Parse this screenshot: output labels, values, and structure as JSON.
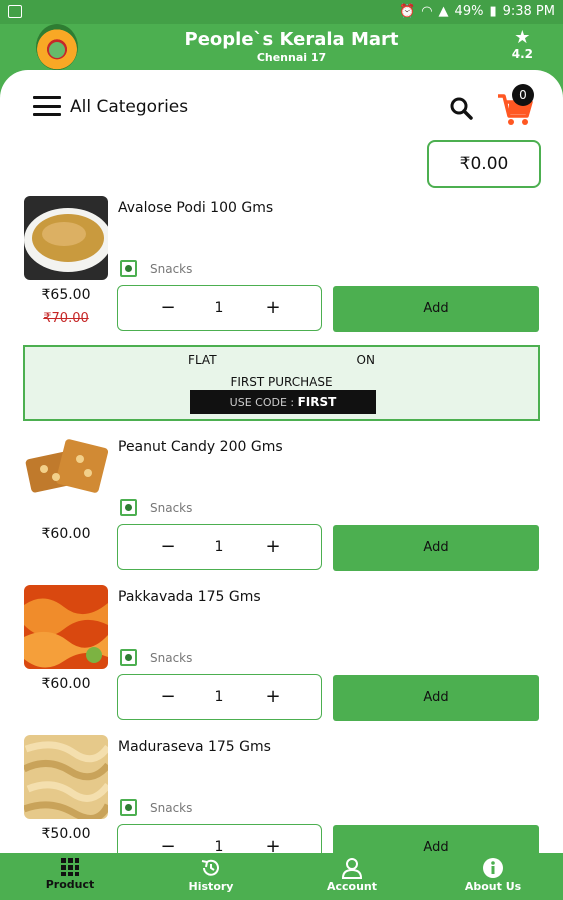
{
  "status_bar": {
    "battery": "49%",
    "time": "9:38 PM"
  },
  "app": {
    "title": "People`s Kerala Mart",
    "subtitle": "Chennai 17",
    "rating": "4.2"
  },
  "toolbar": {
    "category_label": "All Categories",
    "cart_count": "0",
    "total": "₹0.00"
  },
  "products": [
    {
      "name": "Avalose Podi 100 Gms",
      "category": "Snacks",
      "price": "₹65.00",
      "mrp": "₹70.00",
      "qty": "1",
      "add_label": "Add"
    },
    {
      "name": "Peanut Candy 200 Gms",
      "category": "Snacks",
      "price": "₹60.00",
      "mrp": "",
      "qty": "1",
      "add_label": "Add"
    },
    {
      "name": "Pakkavada 175 Gms",
      "category": "Snacks",
      "price": "₹60.00",
      "mrp": "",
      "qty": "1",
      "add_label": "Add"
    },
    {
      "name": "Maduraseva 175 Gms",
      "category": "Snacks",
      "price": "₹50.00",
      "mrp": "",
      "qty": "1",
      "add_label": "Add"
    }
  ],
  "offer": {
    "flat": "FLAT",
    "on": "ON",
    "line2": "FIRST PURCHASE",
    "code_label": "USE CODE :",
    "code": "FIRST"
  },
  "stepper": {
    "minus": "−",
    "plus": "+"
  },
  "bottom_nav": [
    {
      "label": "Product",
      "icon": "grid-icon"
    },
    {
      "label": "History",
      "icon": "history-icon"
    },
    {
      "label": "Account",
      "icon": "account-icon"
    },
    {
      "label": "About Us",
      "icon": "info-icon"
    }
  ],
  "colors": {
    "primary": "#4caf50",
    "offer_bg": "#e8f5e9",
    "cart": "#ff5722",
    "strike": "#c62828"
  }
}
